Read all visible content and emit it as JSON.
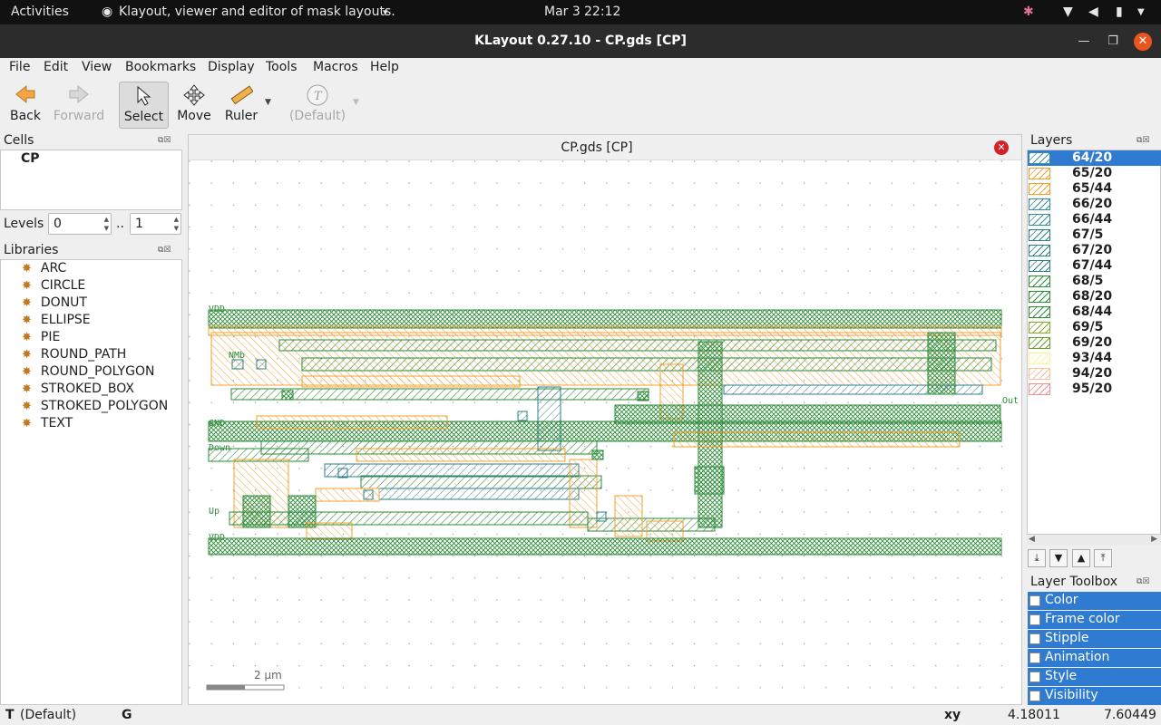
{
  "topbar": {
    "activities": "Activities",
    "app": "Klayout, viewer and editor of mask layouts.",
    "app_dropdown": "▾",
    "date": "Mar 3",
    "time": "22:12"
  },
  "window": {
    "title": "KLayout 0.27.10 - CP.gds [CP]"
  },
  "menu": [
    "File",
    "Edit",
    "View",
    "Bookmarks",
    "Display",
    "Tools",
    "Macros",
    "Help"
  ],
  "toolbar": {
    "back": "Back",
    "forward": "Forward",
    "select": "Select",
    "move": "Move",
    "ruler": "Ruler",
    "default_mode": "(Default)"
  },
  "cells": {
    "title": "Cells",
    "items": [
      "CP"
    ]
  },
  "levels": {
    "label": "Levels",
    "from": "0",
    "sep": "..",
    "to": "1"
  },
  "libraries": {
    "title": "Libraries",
    "items": [
      "ARC",
      "CIRCLE",
      "DONUT",
      "ELLIPSE",
      "PIE",
      "ROUND_PATH",
      "ROUND_POLYGON",
      "STROKED_BOX",
      "STROKED_POLYGON",
      "TEXT"
    ]
  },
  "canvas": {
    "tab_title": "CP.gds [CP]",
    "scale": "2  μm",
    "labels": {
      "vdd_top": "VDD",
      "gnd": "GND",
      "down": "Down",
      "up": "Up",
      "vdd_bottom": "VDD",
      "out": "Out",
      "nmb": "NMb"
    }
  },
  "layers": {
    "title": "Layers",
    "items": [
      {
        "name": "64/20",
        "color": "#3a8c9c",
        "selected": true
      },
      {
        "name": "65/20",
        "color": "#f0a030"
      },
      {
        "name": "65/44",
        "color": "#f0a030"
      },
      {
        "name": "66/20",
        "color": "#3a8c9c"
      },
      {
        "name": "66/44",
        "color": "#3a8c9c"
      },
      {
        "name": "67/5",
        "color": "#2e7d8a"
      },
      {
        "name": "67/20",
        "color": "#2e7d8a"
      },
      {
        "name": "67/44",
        "color": "#2e7d8a"
      },
      {
        "name": "68/5",
        "color": "#2e8b3a"
      },
      {
        "name": "68/20",
        "color": "#2e8b3a"
      },
      {
        "name": "68/44",
        "color": "#2e8b3a"
      },
      {
        "name": "69/5",
        "color": "#8aa830"
      },
      {
        "name": "69/20",
        "color": "#6a9a2a"
      },
      {
        "name": "93/44",
        "color": "#fff3a0"
      },
      {
        "name": "94/20",
        "color": "#f8c0a0"
      },
      {
        "name": "95/20",
        "color": "#f09090"
      }
    ]
  },
  "layer_toolbox": {
    "title": "Layer Toolbox",
    "items": [
      "Color",
      "Frame color",
      "Stipple",
      "Animation",
      "Style",
      "Visibility"
    ]
  },
  "status": {
    "mode": "(Default)",
    "mode_prefix": "T",
    "grid": "G",
    "xy_label": "xy",
    "x": "4.18011",
    "y": "7.60449"
  }
}
